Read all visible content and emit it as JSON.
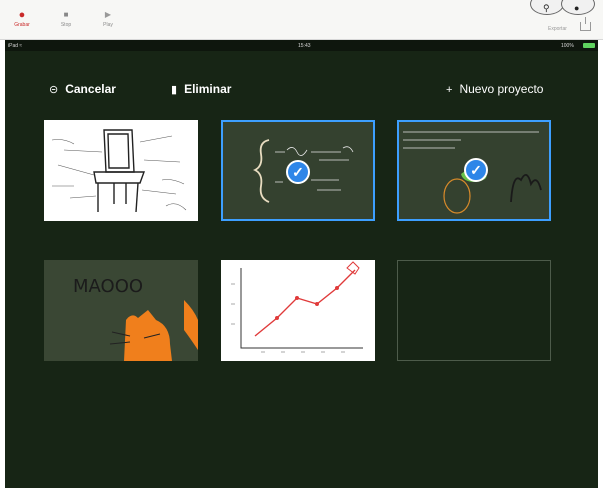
{
  "toolbar": {
    "record_label": "Grabar",
    "stop_label": "Stop",
    "play_label": "Play",
    "export_label": "Exportar"
  },
  "status_bar": {
    "device": "iPad ≈",
    "time": "15:43",
    "battery": "100%"
  },
  "actions": {
    "cancel": "Cancelar",
    "delete": "Eliminar",
    "new_project": "Nuevo proyecto"
  },
  "projects": [
    {
      "content": "chair sketch",
      "selected": false
    },
    {
      "content": "equation system",
      "selected": true
    },
    {
      "content": "handwritten note with drawing",
      "selected": true
    },
    {
      "content": "cat drawing",
      "labels": [
        "MAOOO"
      ],
      "selected": false
    },
    {
      "content": "line graph",
      "selected": false
    },
    {
      "content": "empty",
      "selected": false
    }
  ],
  "colors": {
    "background": "#172515",
    "selection": "#3d9fff",
    "record": "#c92a2a"
  }
}
